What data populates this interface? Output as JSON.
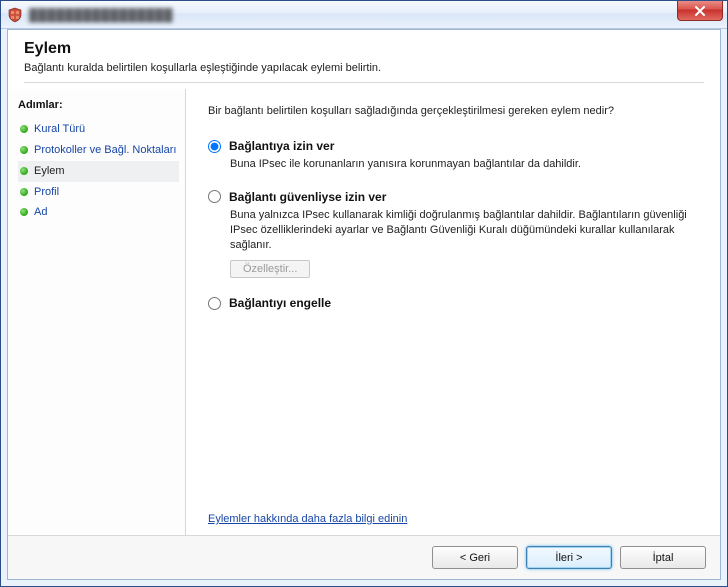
{
  "titlebar": {
    "title_obscured": "████████████████"
  },
  "header": {
    "title": "Eylem",
    "subtitle": "Bağlantı kuralda belirtilen koşullarla eşleştiğinde yapılacak eylemi belirtin."
  },
  "sidebar": {
    "steps_label": "Adımlar:",
    "items": [
      {
        "label": "Kural Türü",
        "current": false
      },
      {
        "label": "Protokoller ve Bağl. Noktaları",
        "current": false
      },
      {
        "label": "Eylem",
        "current": true
      },
      {
        "label": "Profil",
        "current": false
      },
      {
        "label": "Ad",
        "current": false
      }
    ]
  },
  "main": {
    "question": "Bir bağlantı belirtilen koşulları sağladığında gerçekleştirilmesi gereken eylem nedir?",
    "options": {
      "allow": {
        "title": "Bağlantıya izin ver",
        "desc": "Buna IPsec ile korunanların yanısıra korunmayan bağlantılar da dahildir."
      },
      "allow_secure": {
        "title": "Bağlantı güvenliyse izin ver",
        "desc": "Buna yalnızca IPsec kullanarak kimliği doğrulanmış bağlantılar dahildir. Bağlantıların güvenliği IPsec özelliklerindeki ayarlar ve Bağlantı Güvenliği Kuralı düğümündeki kurallar kullanılarak sağlanır.",
        "customize_label": "Özelleştir..."
      },
      "block": {
        "title": "Bağlantıyı engelle"
      }
    },
    "learn_more": "Eylemler hakkında daha fazla bilgi edinin"
  },
  "footer": {
    "back": "< Geri",
    "next": "İleri >",
    "cancel": "İptal"
  }
}
